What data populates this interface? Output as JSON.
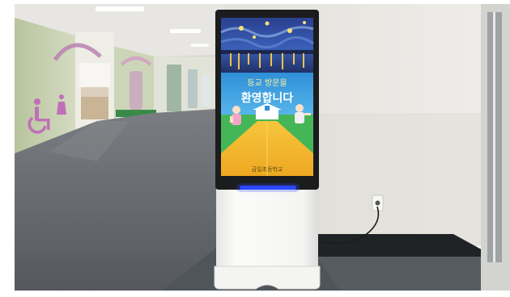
{
  "photo": {
    "subject": "digital signage kiosk in school hallway"
  },
  "kiosk": {
    "screen": {
      "line1": "등교 방문을",
      "line2": "환영합니다",
      "footer": "금일초등학교"
    },
    "indicator_color": "#2b49ff"
  },
  "colors": {
    "wall": "#e9e7e2",
    "floor": "#5d6166",
    "kiosk_body": "#f6f6f4",
    "screen_frame": "#1d1d1f",
    "sky_top": "#1f3a8a",
    "grass": "#45b657",
    "road": "#f2b830",
    "accessibility_purple": "#c070b8"
  }
}
